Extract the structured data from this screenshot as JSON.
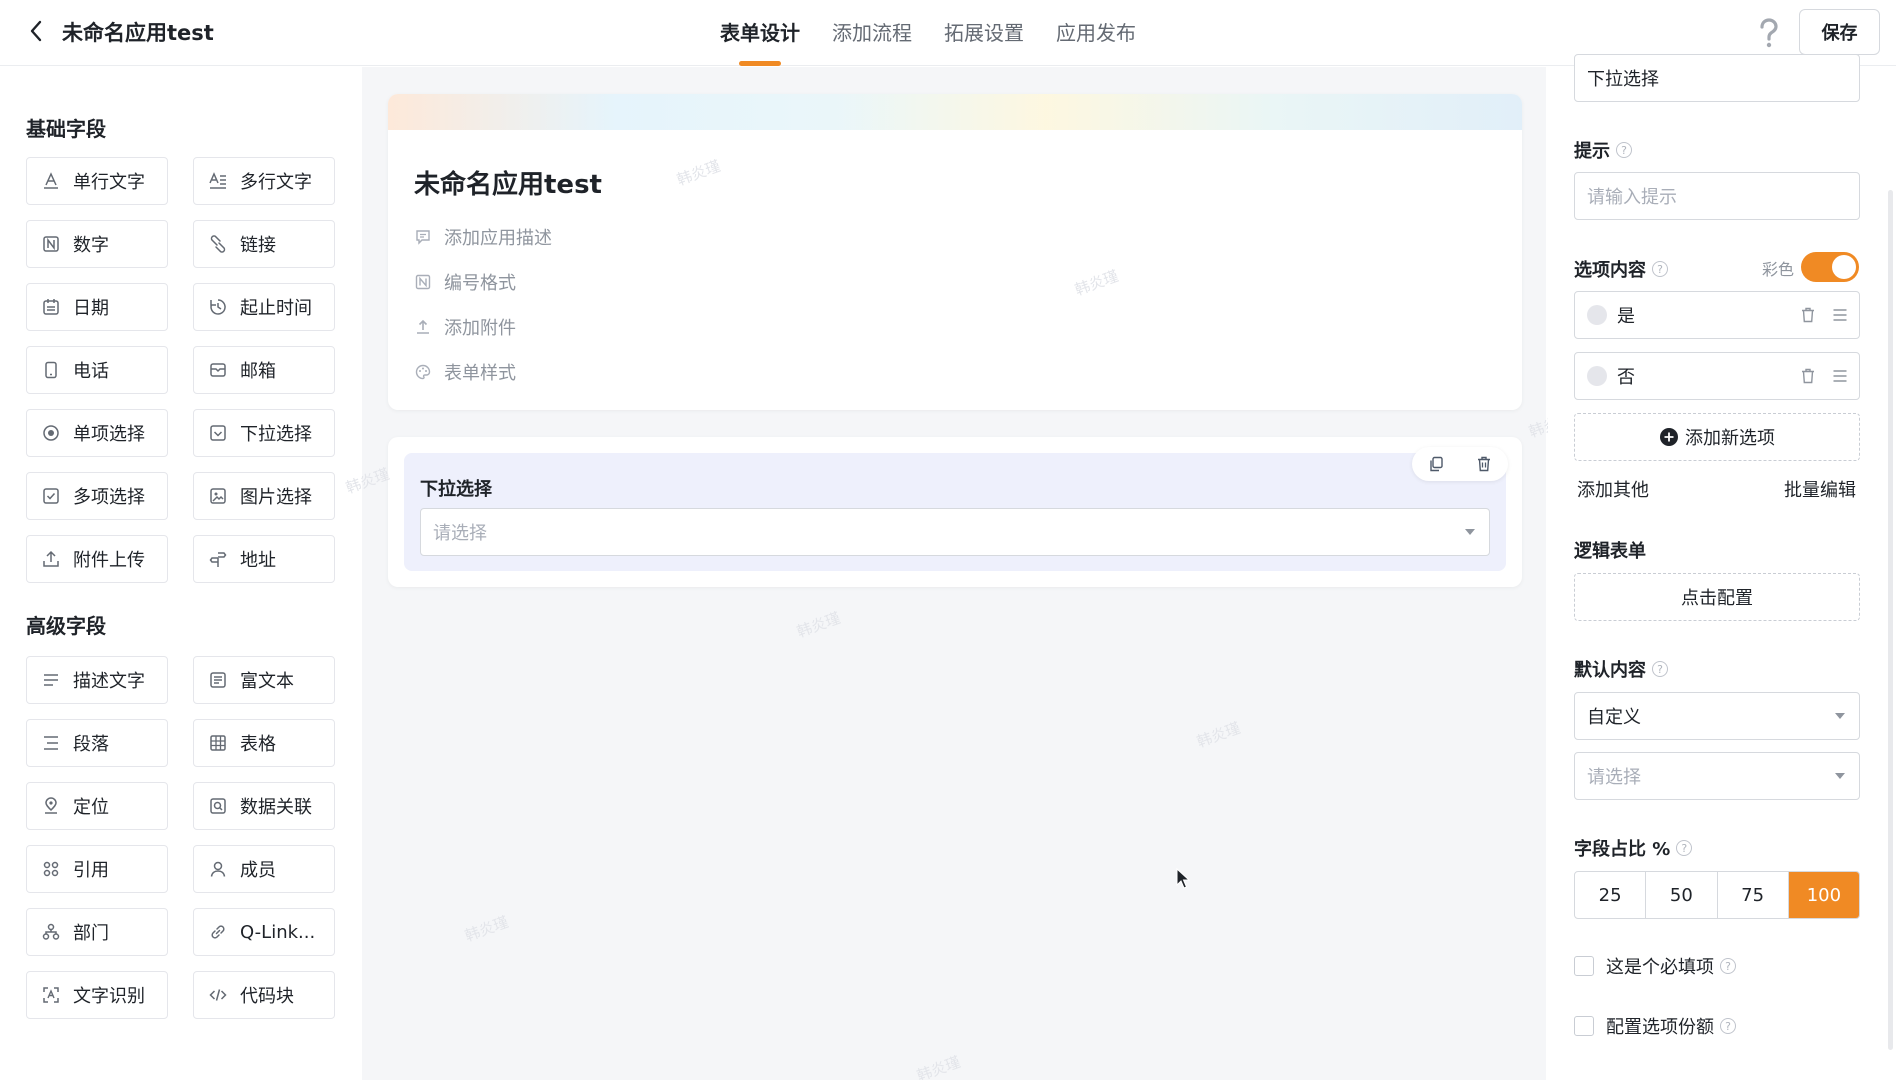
{
  "header": {
    "app_title": "未命名应用test",
    "tabs": [
      {
        "label": "表单设计",
        "active": true
      },
      {
        "label": "添加流程"
      },
      {
        "label": "拓展设置"
      },
      {
        "label": "应用发布"
      }
    ],
    "save_label": "保存",
    "accent_color": "#f08a24"
  },
  "left_panel": {
    "basic_title": "基础字段",
    "basic_fields": [
      {
        "label": "单行文字",
        "icon": "single-line-text-icon"
      },
      {
        "label": "多行文字",
        "icon": "multi-line-text-icon"
      },
      {
        "label": "数字",
        "icon": "number-icon"
      },
      {
        "label": "链接",
        "icon": "link-icon"
      },
      {
        "label": "日期",
        "icon": "calendar-icon"
      },
      {
        "label": "起止时间",
        "icon": "time-range-icon"
      },
      {
        "label": "电话",
        "icon": "phone-icon"
      },
      {
        "label": "邮箱",
        "icon": "mail-icon"
      },
      {
        "label": "单项选择",
        "icon": "radio-icon"
      },
      {
        "label": "下拉选择",
        "icon": "dropdown-icon"
      },
      {
        "label": "多项选择",
        "icon": "checkbox-icon"
      },
      {
        "label": "图片选择",
        "icon": "image-icon"
      },
      {
        "label": "附件上传",
        "icon": "upload-icon"
      },
      {
        "label": "地址",
        "icon": "address-icon"
      }
    ],
    "advanced_title": "高级字段",
    "advanced_fields": [
      {
        "label": "描述文字",
        "icon": "description-icon"
      },
      {
        "label": "富文本",
        "icon": "rich-text-icon"
      },
      {
        "label": "段落",
        "icon": "paragraph-icon"
      },
      {
        "label": "表格",
        "icon": "table-icon"
      },
      {
        "label": "定位",
        "icon": "location-icon"
      },
      {
        "label": "数据关联",
        "icon": "data-link-icon"
      },
      {
        "label": "引用",
        "icon": "reference-icon"
      },
      {
        "label": "成员",
        "icon": "member-icon"
      },
      {
        "label": "部门",
        "icon": "department-icon"
      },
      {
        "label": "Q-Link...",
        "icon": "qlink-icon"
      },
      {
        "label": "文字识别",
        "icon": "ocr-icon"
      },
      {
        "label": "代码块",
        "icon": "code-icon"
      }
    ]
  },
  "canvas": {
    "form_title": "未命名应用test",
    "meta": [
      {
        "label": "添加应用描述",
        "icon": "comment-icon"
      },
      {
        "label": "编号格式",
        "icon": "number-format-icon"
      },
      {
        "label": "添加附件",
        "icon": "attachment-upload-icon"
      },
      {
        "label": "表单样式",
        "icon": "palette-icon"
      }
    ],
    "field": {
      "label": "下拉选择",
      "placeholder": "请选择"
    },
    "watermark": "韩炎瑾"
  },
  "right_panel": {
    "title_value": "下拉选择",
    "hint_label": "提示",
    "hint_placeholder": "请输入提示",
    "options_label": "选项内容",
    "color_label": "彩色",
    "color_enabled": true,
    "options": [
      "是",
      "否"
    ],
    "add_option_label": "添加新选项",
    "add_other_label": "添加其他",
    "bulk_edit_label": "批量编辑",
    "logic_label": "逻辑表单",
    "logic_button": "点击配置",
    "default_label": "默认内容",
    "default_mode": "自定义",
    "default_placeholder": "请选择",
    "width_label": "字段占比 %",
    "width_options": [
      "25",
      "50",
      "75",
      "100"
    ],
    "width_selected": "100",
    "required_label": "这是个必填项",
    "quota_label": "配置选项份额"
  }
}
